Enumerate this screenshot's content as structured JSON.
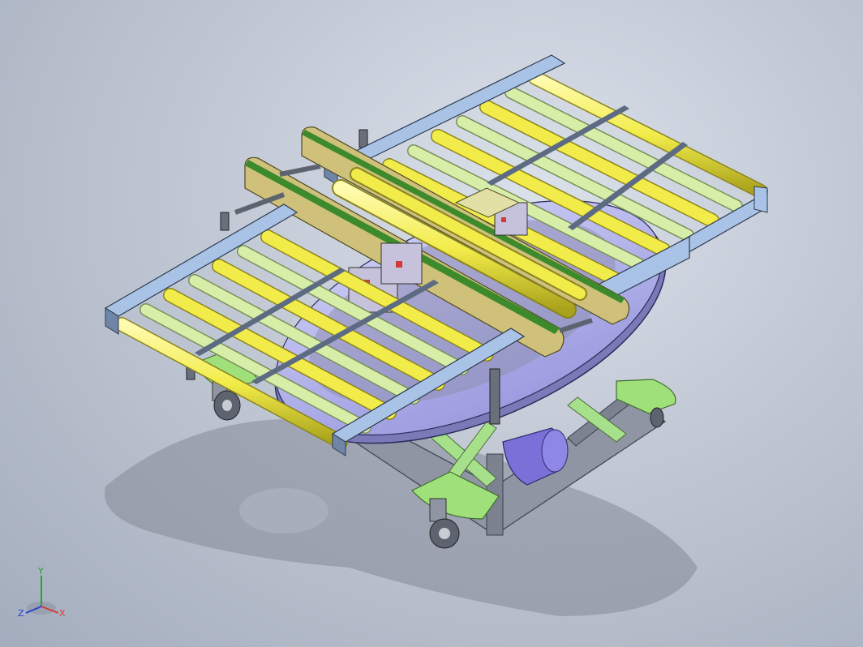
{
  "viewport": {
    "background": "#b9c0cc"
  },
  "colors": {
    "frame_blue": "#a9c3e6",
    "frame_dark": "#5d6b82",
    "roller_yellow": "#f4f06a",
    "roller_green": "#d7eea8",
    "belt_green": "#3c8a2c",
    "belt_tan": "#cfc07a",
    "turntable": "#b4b4ea",
    "base_green": "#9fe07a",
    "motor": "#7a70d8",
    "base_steel": "#8f95a2"
  },
  "triad": {
    "x_label": "X",
    "y_label": "Y",
    "z_label": "Z",
    "x_color": "#d43a3a",
    "y_color": "#2e9e3a",
    "z_color": "#2c3fcf"
  }
}
